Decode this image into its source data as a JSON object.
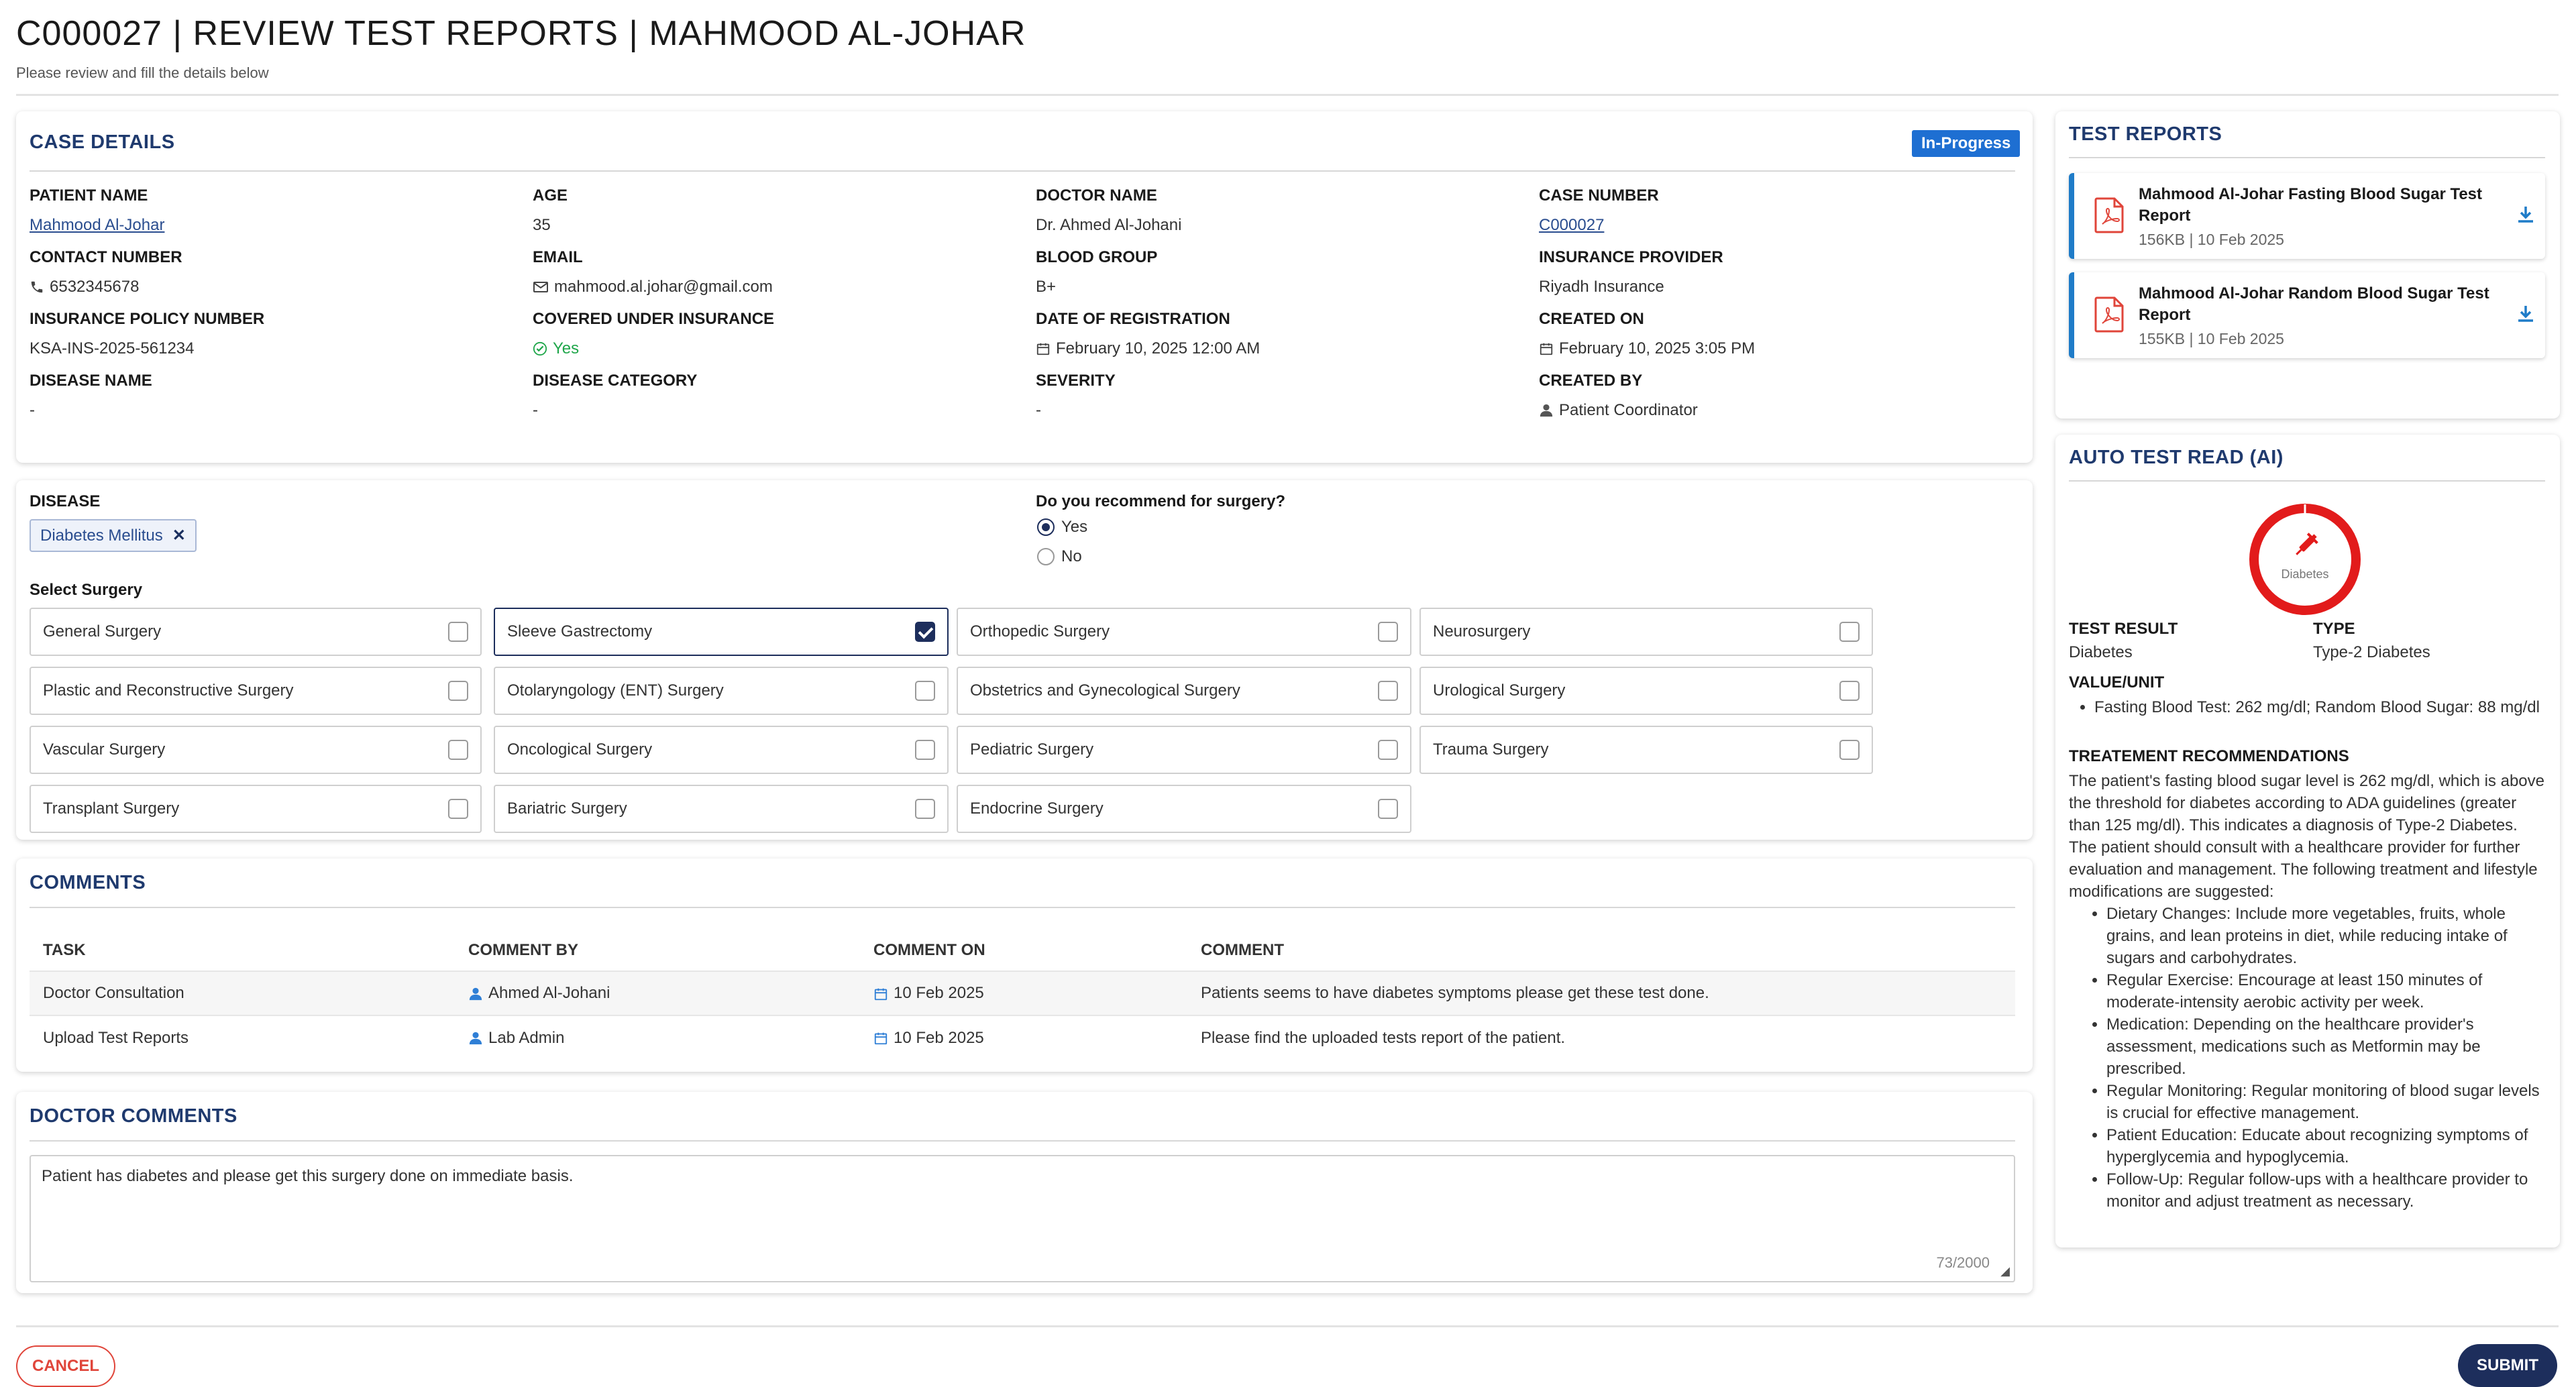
{
  "header": {
    "title": "C000027 | REVIEW TEST REPORTS | MAHMOOD AL-JOHAR",
    "subtitle": "Please review and fill the details below"
  },
  "case_details": {
    "title": "CASE DETAILS",
    "status": "In-Progress",
    "fields": {
      "patient_name": {
        "label": "PATIENT NAME",
        "value": "Mahmood Al-Johar"
      },
      "age": {
        "label": "AGE",
        "value": "35"
      },
      "doctor_name": {
        "label": "DOCTOR NAME",
        "value": "Dr. Ahmed Al-Johani"
      },
      "case_number": {
        "label": "CASE NUMBER",
        "value": "C000027"
      },
      "contact_number": {
        "label": "CONTACT NUMBER",
        "value": "6532345678"
      },
      "email": {
        "label": "EMAIL",
        "value": "mahmood.al.johar@gmail.com"
      },
      "blood_group": {
        "label": "BLOOD GROUP",
        "value": "B+"
      },
      "insurance_provider": {
        "label": "INSURANCE PROVIDER",
        "value": "Riyadh Insurance"
      },
      "policy_number": {
        "label": "INSURANCE POLICY NUMBER",
        "value": "KSA-INS-2025-561234"
      },
      "covered": {
        "label": "COVERED UNDER INSURANCE",
        "value": "Yes"
      },
      "registration_date": {
        "label": "DATE OF REGISTRATION",
        "value": "February 10, 2025 12:00 AM"
      },
      "created_on": {
        "label": "CREATED ON",
        "value": "February 10, 2025 3:05 PM"
      },
      "disease_name": {
        "label": "DISEASE NAME",
        "value": "-"
      },
      "disease_category": {
        "label": "DISEASE CATEGORY",
        "value": "-"
      },
      "severity": {
        "label": "SEVERITY",
        "value": "-"
      },
      "created_by": {
        "label": "CREATED BY",
        "value": "Patient Coordinator"
      }
    }
  },
  "disease": {
    "label": "DISEASE",
    "chip": "Diabetes Mellitus",
    "surgery_question": "Do you recommend for surgery?",
    "options": {
      "yes": "Yes",
      "no": "No"
    },
    "selected": "Yes",
    "select_surgery_label": "Select Surgery",
    "surgeries": [
      {
        "name": "General Surgery",
        "checked": false
      },
      {
        "name": "Sleeve Gastrectomy",
        "checked": true
      },
      {
        "name": "Orthopedic Surgery",
        "checked": false
      },
      {
        "name": "Neurosurgery",
        "checked": false
      },
      {
        "name": "Plastic and Reconstructive Surgery",
        "checked": false
      },
      {
        "name": "Otolaryngology (ENT) Surgery",
        "checked": false
      },
      {
        "name": "Obstetrics and Gynecological Surgery",
        "checked": false
      },
      {
        "name": "Urological Surgery",
        "checked": false
      },
      {
        "name": "Vascular Surgery",
        "checked": false
      },
      {
        "name": "Oncological Surgery",
        "checked": false
      },
      {
        "name": "Pediatric Surgery",
        "checked": false
      },
      {
        "name": "Trauma Surgery",
        "checked": false
      },
      {
        "name": "Transplant Surgery",
        "checked": false
      },
      {
        "name": "Bariatric Surgery",
        "checked": false
      },
      {
        "name": "Endocrine Surgery",
        "checked": false
      }
    ]
  },
  "comments": {
    "title": "COMMENTS",
    "columns": {
      "task": "TASK",
      "by": "COMMENT BY",
      "on": "COMMENT ON",
      "comment": "COMMENT"
    },
    "rows": [
      {
        "task": "Doctor Consultation",
        "by": "Ahmed Al-Johani",
        "on": "10 Feb 2025",
        "comment": "Patients seems to have diabetes symptoms please get these test done."
      },
      {
        "task": "Upload Test Reports",
        "by": "Lab Admin",
        "on": "10 Feb 2025",
        "comment": "Please find the uploaded tests report of the patient."
      }
    ]
  },
  "doctor_comments": {
    "title": "DOCTOR COMMENTS",
    "value": "Patient has diabetes and please get this surgery done on immediate basis.",
    "counter": "73/2000"
  },
  "test_reports": {
    "title": "TEST REPORTS",
    "items": [
      {
        "name": "Mahmood Al-Johar Fasting Blood Sugar Test Report",
        "meta": "156KB | 10 Feb 2025"
      },
      {
        "name": "Mahmood Al-Johar Random Blood Sugar Test Report",
        "meta": "155KB | 10 Feb 2025"
      }
    ]
  },
  "ai": {
    "title": "AUTO TEST READ (AI)",
    "ring_label": "Diabetes",
    "test_result_label": "TEST RESULT",
    "test_result": "Diabetes",
    "type_label": "TYPE",
    "type": "Type-2 Diabetes",
    "value_unit_label": "VALUE/UNIT",
    "value_unit": "Fasting Blood Test: 262 mg/dl; Random Blood Sugar: 88 mg/dl",
    "recommendations_label": "TREATEMENT RECOMMENDATIONS",
    "recommendations_intro": "The patient's fasting blood sugar level is 262 mg/dl, which is above the threshold for diabetes according to ADA guidelines (greater than 125 mg/dl). This indicates a diagnosis of Type-2 Diabetes. The patient should consult with a healthcare provider for further evaluation and management. The following treatment and lifestyle modifications are suggested:",
    "recommendations": [
      "Dietary Changes: Include more vegetables, fruits, whole grains, and lean proteins in diet, while reducing intake of sugars and carbohydrates.",
      "Regular Exercise: Encourage at least 150 minutes of moderate-intensity aerobic activity per week.",
      "Medication: Depending on the healthcare provider's assessment, medications such as Metformin may be prescribed.",
      "Regular Monitoring: Regular monitoring of blood sugar levels is crucial for effective management.",
      "Patient Education: Educate about recognizing symptoms of hyperglycemia and hypoglycemia.",
      "Follow-Up: Regular follow-ups with a healthcare provider to monitor and adjust treatment as necessary."
    ]
  },
  "actions": {
    "cancel": "CANCEL",
    "submit": "SUBMIT"
  },
  "colors": {
    "primary": "#1d2e5c",
    "accent": "#1e6fd2",
    "danger": "#e0453a",
    "success": "#1fa64a"
  }
}
